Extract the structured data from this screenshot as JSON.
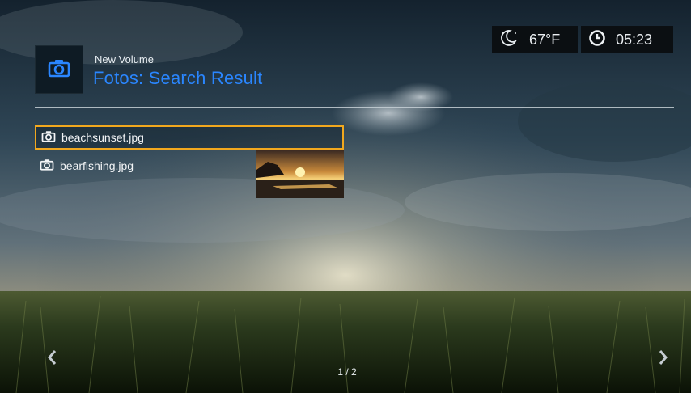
{
  "header": {
    "icon": "camera-icon",
    "volume_name": "New Volume",
    "title": "Fotos: Search Result"
  },
  "status": {
    "weather_icon": "moon-night-icon",
    "temperature": "67°F",
    "clock_icon": "clock-icon",
    "time": "05:23"
  },
  "files": [
    {
      "name": "beachsunset.jpg",
      "icon": "camera-icon",
      "selected": true
    },
    {
      "name": "bearfishing.jpg",
      "icon": "camera-icon",
      "selected": false
    }
  ],
  "preview": {
    "icon": "sunset-thumbnail"
  },
  "pagination": {
    "label": "1 / 2",
    "prev_icon": "chevron-left-icon",
    "next_icon": "chevron-right-icon"
  },
  "colors": {
    "accent_blue": "#2a86ff",
    "selection_orange": "#f2a81e"
  }
}
